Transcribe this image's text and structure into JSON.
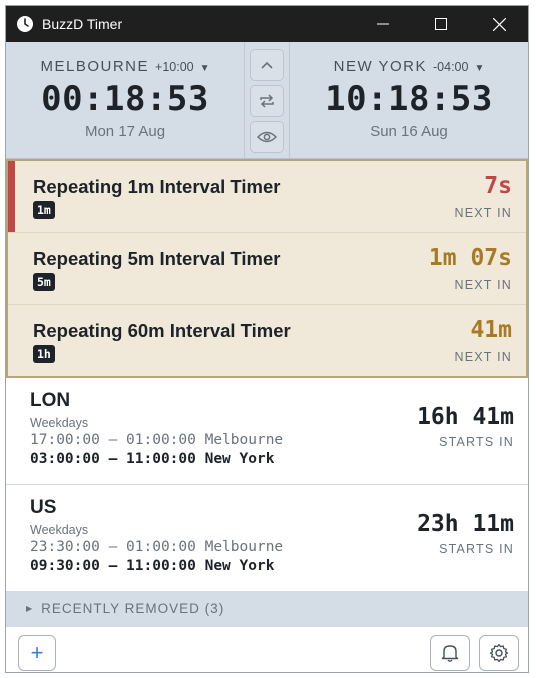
{
  "window": {
    "title": "BuzzD Timer"
  },
  "clocks": {
    "left": {
      "city": "MELBOURNE",
      "offset": "+10:00",
      "time": "00:18:53",
      "date": "Mon 17 Aug"
    },
    "right": {
      "city": "NEW YORK",
      "offset": "-04:00",
      "time": "10:18:53",
      "date": "Sun 16 Aug"
    }
  },
  "timers": [
    {
      "name": "Repeating 1m Interval Timer",
      "badge": "1m",
      "value": "7s",
      "sub": "NEXT IN",
      "color": "#c14646"
    },
    {
      "name": "Repeating 5m Interval Timer",
      "badge": "5m",
      "value": "1m 07s",
      "sub": "NEXT IN",
      "color": "#a87a24"
    },
    {
      "name": "Repeating 60m Interval Timer",
      "badge": "1h",
      "value": "41m",
      "sub": "NEXT IN",
      "color": "#a87a24"
    }
  ],
  "sessions": [
    {
      "name": "LON",
      "days": "Weekdays",
      "line1": "17:00:00 – 01:00:00 Melbourne",
      "line2": "03:00:00 – 11:00:00 New York",
      "value": "16h 41m",
      "sub": "STARTS IN"
    },
    {
      "name": "US",
      "days": "Weekdays",
      "line1": "23:30:00 – 01:00:00 Melbourne",
      "line2": "09:30:00 – 11:00:00 New York",
      "value": "23h 11m",
      "sub": "STARTS IN"
    }
  ],
  "removed": {
    "label": "RECENTLY REMOVED (3)"
  },
  "footer": {
    "add_label": "+"
  },
  "colors": {
    "accent_red": "#c14646",
    "accent_amber": "#a87a24",
    "timer_bg": "#f0e8d9",
    "header_bg": "#d4dce5"
  },
  "icons": [
    "app-clock-icon",
    "minimize-icon",
    "maximize-icon",
    "close-icon",
    "chevron-up-icon",
    "swap-icon",
    "eye-icon",
    "caret-down-icon",
    "bell-icon",
    "gear-icon"
  ]
}
